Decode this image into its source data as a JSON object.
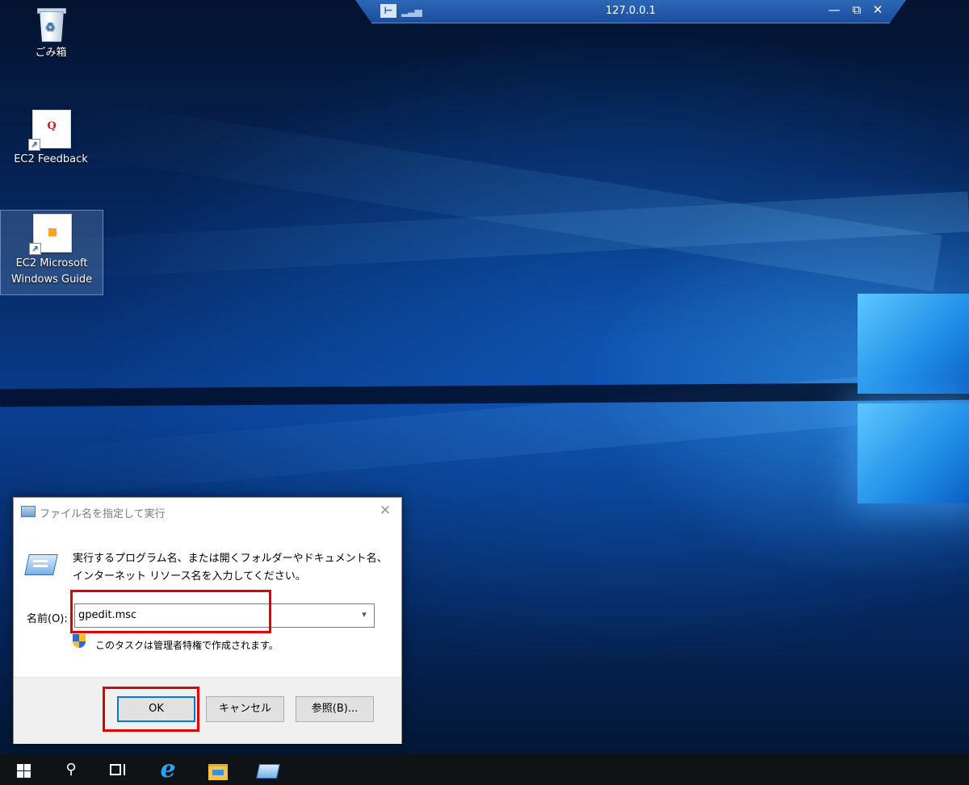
{
  "remote_bar": {
    "title": "127.0.0.1",
    "pin_icon": "pin-icon",
    "signal_icon": "signal-bars-icon",
    "minimize": "—",
    "restore": "⧉",
    "close": "✕"
  },
  "desktop": {
    "icons": [
      {
        "label": "ごみ箱",
        "icon": "recycle-bin-icon"
      },
      {
        "label": "EC2 Feedback",
        "icon_text": "Q",
        "icon": "ec2-feedback-icon"
      },
      {
        "label_line1": "EC2 Microsoft",
        "label_line2": "Windows Guide",
        "icon": "ec2-guide-icon"
      }
    ]
  },
  "run_dialog": {
    "title": "ファイル名を指定して実行",
    "description": "実行するプログラム名、または開くフォルダーやドキュメント名、インターネット リソース名を入力してください。",
    "name_label": "名前(O):",
    "input_value": "gpedit.msc",
    "admin_note": "このタスクは管理者特権で作成されます。",
    "ok_label": "OK",
    "cancel_label": "キャンセル",
    "browse_label": "参照(B)...",
    "close_glyph": "✕",
    "dropdown_glyph": "▾"
  },
  "annotations": {
    "color": "#e00000"
  },
  "taskbar": {
    "items": [
      "start-icon",
      "search-icon",
      "task-view-icon",
      "internet-explorer-icon",
      "file-explorer-icon",
      "run-icon"
    ],
    "search_glyph": "⚲",
    "ie_glyph": "e"
  },
  "colors": {
    "desktop": "#0a3e8f",
    "taskbar": "#101316",
    "accent": "#0078d7"
  }
}
